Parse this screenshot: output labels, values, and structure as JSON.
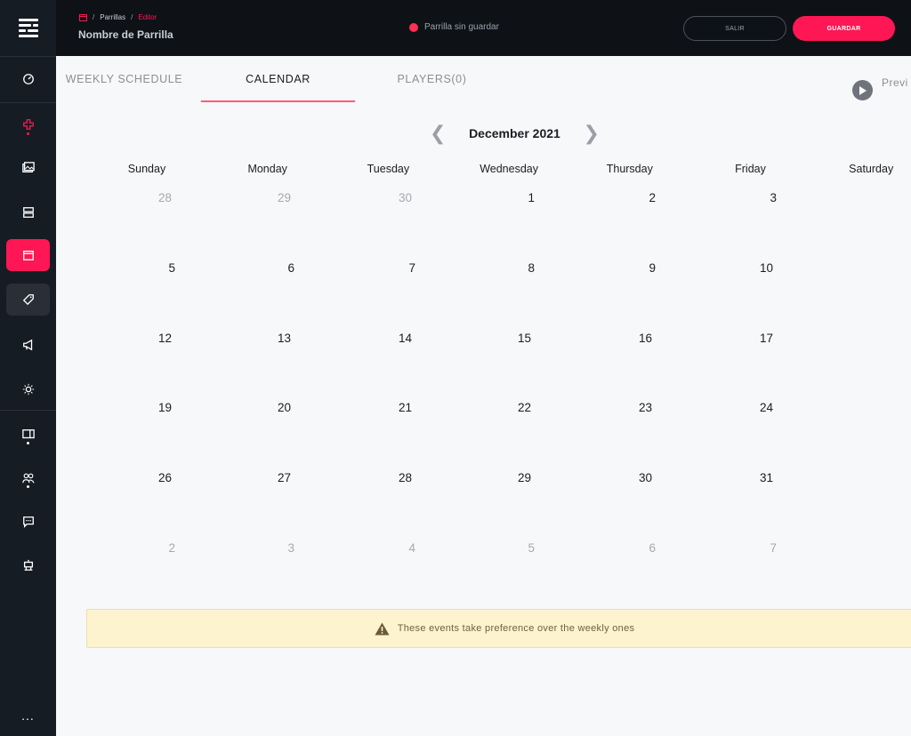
{
  "breadcrumb": {
    "home_icon": "calendar-icon",
    "parent": "Parrillas",
    "current": "Editor",
    "separator": "/"
  },
  "document_title": "Nombre de Parrilla",
  "save_status": {
    "text": "Parrilla sin guardar",
    "color": "#ff2f52"
  },
  "buttons": {
    "exit": "SALIR",
    "save": "GUARDAR"
  },
  "colors": {
    "accent": "#ff1654",
    "sidebar_bg": "#161c24",
    "topbar_bg": "#0e1217",
    "notice_bg": "#fdf3cf"
  },
  "sidebar": {
    "logo_icon": "stack-logo-icon",
    "items": [
      {
        "icon": "dashboard-icon",
        "state": "normal"
      },
      {
        "icon": "gamepad-icon",
        "state": "normal"
      },
      {
        "icon": "images-icon",
        "state": "normal"
      },
      {
        "icon": "server-icon",
        "state": "normal"
      },
      {
        "icon": "calendar-icon",
        "state": "active"
      },
      {
        "icon": "tag-icon",
        "state": "hover"
      },
      {
        "icon": "megaphone-icon",
        "state": "normal"
      },
      {
        "icon": "brightness-icon",
        "state": "normal"
      },
      {
        "icon": "display-icon",
        "state": "normal"
      },
      {
        "icon": "users-icon",
        "state": "normal"
      },
      {
        "icon": "chat-icon",
        "state": "normal"
      },
      {
        "icon": "robot-icon",
        "state": "normal"
      }
    ],
    "more": "..."
  },
  "tabs": [
    {
      "label": "WEEKLY SCHEDULE",
      "active": false
    },
    {
      "label": "CALENDAR",
      "active": true
    },
    {
      "label": "PLAYERS(0)",
      "active": false
    }
  ],
  "preview": {
    "label": "Previ",
    "icon": "play-icon"
  },
  "calendar": {
    "month_label": "December 2021",
    "prev_icon": "chevron-left-icon",
    "next_icon": "chevron-right-icon",
    "weekdays": [
      "Sunday",
      "Monday",
      "Tuesday",
      "Wednesday",
      "Thursday",
      "Friday",
      "Saturday"
    ],
    "weeks": [
      [
        {
          "d": "28",
          "m": true
        },
        {
          "d": "29",
          "m": true
        },
        {
          "d": "30",
          "m": true
        },
        {
          "d": "1",
          "m": false
        },
        {
          "d": "2",
          "m": false
        },
        {
          "d": "3",
          "m": false
        }
      ],
      [
        {
          "d": "5",
          "m": false
        },
        {
          "d": "6",
          "m": false
        },
        {
          "d": "7",
          "m": false
        },
        {
          "d": "8",
          "m": false
        },
        {
          "d": "9",
          "m": false
        },
        {
          "d": "10",
          "m": false
        }
      ],
      [
        {
          "d": "12",
          "m": false
        },
        {
          "d": "13",
          "m": false
        },
        {
          "d": "14",
          "m": false
        },
        {
          "d": "15",
          "m": false
        },
        {
          "d": "16",
          "m": false
        },
        {
          "d": "17",
          "m": false
        }
      ],
      [
        {
          "d": "19",
          "m": false
        },
        {
          "d": "20",
          "m": false
        },
        {
          "d": "21",
          "m": false
        },
        {
          "d": "22",
          "m": false
        },
        {
          "d": "23",
          "m": false
        },
        {
          "d": "24",
          "m": false
        }
      ],
      [
        {
          "d": "26",
          "m": false
        },
        {
          "d": "27",
          "m": false
        },
        {
          "d": "28",
          "m": false
        },
        {
          "d": "29",
          "m": false
        },
        {
          "d": "30",
          "m": false
        },
        {
          "d": "31",
          "m": false
        }
      ],
      [
        {
          "d": "2",
          "m": true
        },
        {
          "d": "3",
          "m": true
        },
        {
          "d": "4",
          "m": true
        },
        {
          "d": "5",
          "m": true
        },
        {
          "d": "6",
          "m": true
        },
        {
          "d": "7",
          "m": true
        }
      ]
    ]
  },
  "notice": {
    "icon": "warning-icon",
    "text": "These events take preference over the weekly ones"
  }
}
